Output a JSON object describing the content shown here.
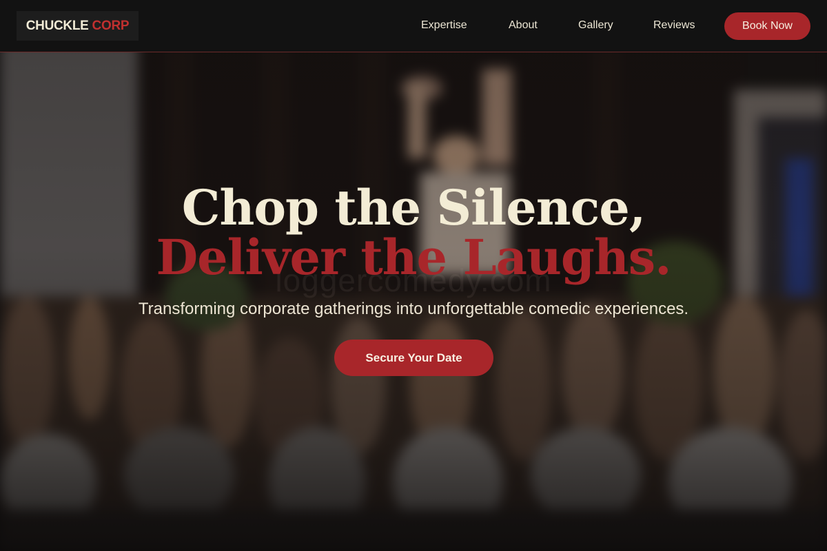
{
  "brand": {
    "name_primary": "CHUCKLE",
    "name_accent": "CORP"
  },
  "nav": {
    "items": [
      {
        "label": "Expertise"
      },
      {
        "label": "About"
      },
      {
        "label": "Gallery"
      },
      {
        "label": "Reviews"
      }
    ],
    "cta_label": "Book Now"
  },
  "hero": {
    "headline_line1": "Chop the Silence,",
    "headline_line2": "Deliver the Laughs.",
    "subheadline": "Transforming corporate gatherings into unforgettable comedic experiences.",
    "cta_label": "Secure Your Date",
    "watermark": "loggercomedy.com"
  },
  "colors": {
    "accent": "#a8262a",
    "cream": "#f3ecd5",
    "navbar": "#121212"
  }
}
